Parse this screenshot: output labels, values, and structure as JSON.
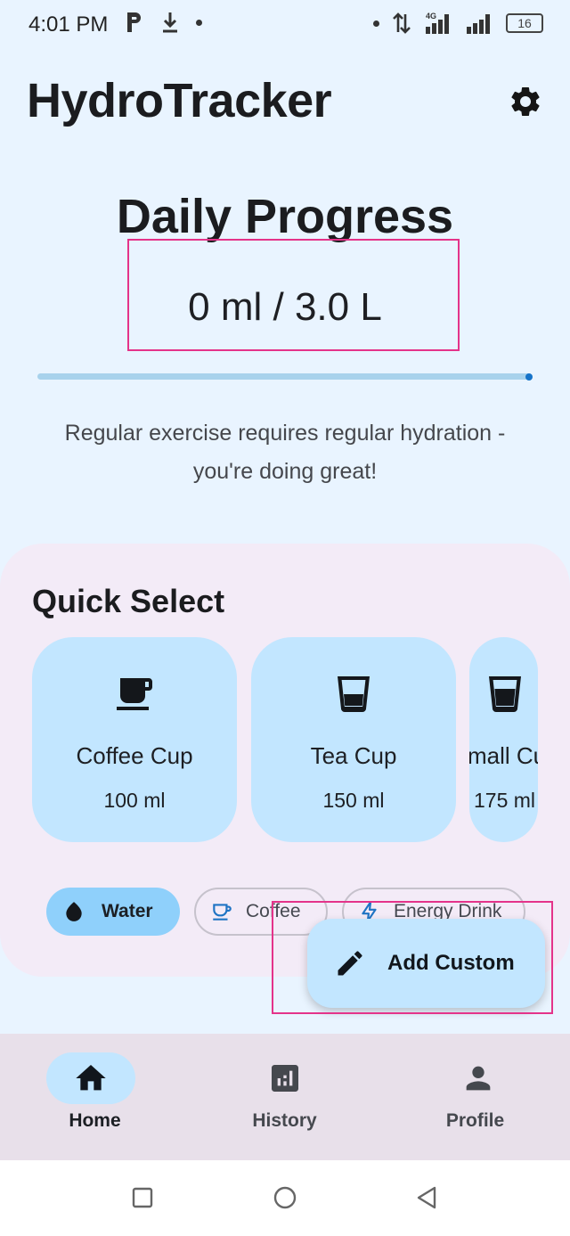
{
  "status_bar": {
    "time": "4:01 PM",
    "battery": "16",
    "icons": [
      "parking-icon",
      "download-icon",
      "dot-icon",
      "dot-icon",
      "data-arrows-icon",
      "signal-4g-icon",
      "signal-icon",
      "battery-icon"
    ]
  },
  "header": {
    "title": "HydroTracker",
    "settings_icon": "gear-icon"
  },
  "progress": {
    "title": "Daily Progress",
    "value": "0 ml / 3.0 L",
    "fraction": 0.0,
    "message": "Regular exercise requires regular hydration - you're doing great!"
  },
  "quick_select": {
    "title": "Quick Select",
    "cards": [
      {
        "name": "Coffee Cup",
        "amount": "100 ml",
        "icon": "coffee-cup-icon"
      },
      {
        "name": "Tea Cup",
        "amount": "150 ml",
        "icon": "glass-icon"
      },
      {
        "name": "mall Cu",
        "amount": "175 ml",
        "icon": "glass-icon"
      }
    ],
    "chips": [
      {
        "label": "Water",
        "icon": "water-drop-icon",
        "selected": true
      },
      {
        "label": "Coffee",
        "icon": "coffee-icon",
        "selected": false
      },
      {
        "label": "Energy Drink",
        "icon": "bolt-icon",
        "selected": false
      }
    ]
  },
  "fab": {
    "label": "Add Custom",
    "icon": "pencil-icon"
  },
  "bottom_nav": {
    "items": [
      {
        "label": "Home",
        "icon": "home-icon",
        "active": true
      },
      {
        "label": "History",
        "icon": "bar-chart-icon",
        "active": false
      },
      {
        "label": "Profile",
        "icon": "person-icon",
        "active": false
      }
    ]
  },
  "colors": {
    "background": "#e9f4ff",
    "card": "#c2e6ff",
    "chip_selected": "#8fd0fb",
    "panel": "#f3ebf7",
    "nav": "#e8e0ea",
    "highlight": "#e4338a",
    "progress_track": "#a8d2ec",
    "progress_dot": "#1673c9"
  }
}
